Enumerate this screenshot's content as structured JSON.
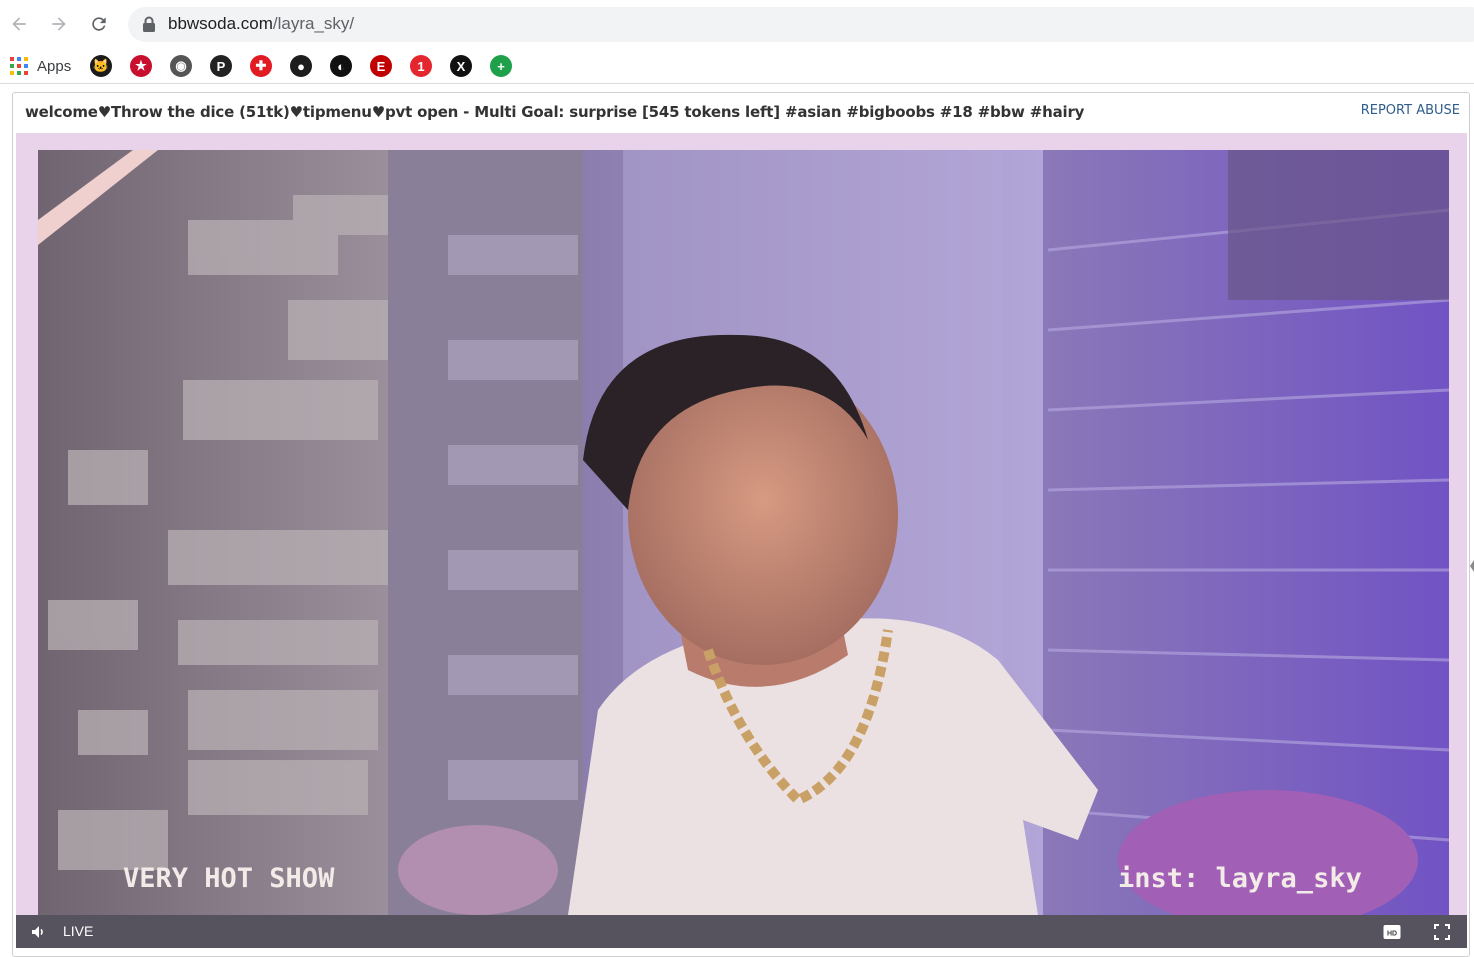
{
  "browser": {
    "url_host": "bbwsoda.com",
    "url_path": "/layra_sky/",
    "bookmarks": {
      "apps_label": "Apps",
      "icons": [
        {
          "name": "bookmark-cat-icon",
          "color": "#1b1b1b",
          "glyph": "🐱"
        },
        {
          "name": "bookmark-star-icon",
          "color": "#c8102e",
          "glyph": "★"
        },
        {
          "name": "bookmark-globe-icon",
          "color": "#555555",
          "glyph": "◉"
        },
        {
          "name": "bookmark-p-icon",
          "color": "#222222",
          "glyph": "P"
        },
        {
          "name": "bookmark-cross-icon",
          "color": "#e21b23",
          "glyph": "✚"
        },
        {
          "name": "bookmark-circle-icon",
          "color": "#1d1d1d",
          "glyph": "●"
        },
        {
          "name": "bookmark-round-icon",
          "color": "#111111",
          "glyph": "◐"
        },
        {
          "name": "bookmark-e-icon",
          "color": "#c00000",
          "glyph": "E"
        },
        {
          "name": "bookmark-one-icon",
          "color": "#e4262e",
          "glyph": "1"
        },
        {
          "name": "bookmark-x-icon",
          "color": "#111111",
          "glyph": "X"
        },
        {
          "name": "bookmark-plus-icon",
          "color": "#1fa04a",
          "glyph": "+"
        }
      ]
    }
  },
  "room": {
    "subject": "welcome♥Throw the dice (51tk)♥tipmenu♥pvt open - Multi Goal: surprise [545 tokens left] #asian #bigboobs #18 #bbw #hairy",
    "report_label": "REPORT ABUSE"
  },
  "video": {
    "overlay_left": "VERY HOT SHOW",
    "overlay_right": "inst: layra_sky",
    "live_label": "LIVE",
    "hd_label": "HD"
  },
  "colors": {
    "accent_link": "#2f5d8c",
    "video_border": "#e9d3ea",
    "control_bar": "#3c3c46"
  }
}
